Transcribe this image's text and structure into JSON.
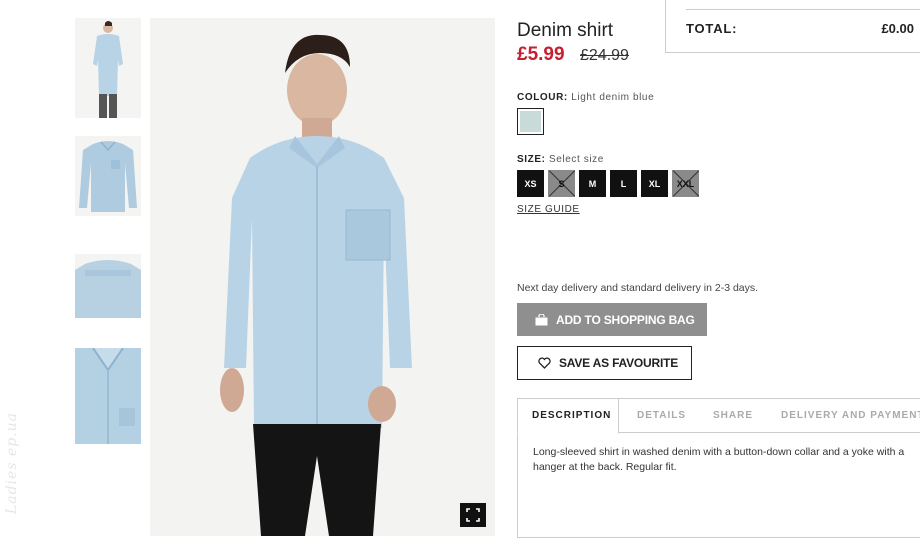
{
  "product": {
    "title": "Denim shirt",
    "price_sale": "£5.99",
    "price_original": "£24.99"
  },
  "cart": {
    "total_label": "TOTAL:",
    "total_value": "£0.00"
  },
  "colour": {
    "label": "COLOUR:",
    "value": "Light denim blue",
    "swatch_color": "#c9dbd9"
  },
  "size": {
    "label": "SIZE:",
    "placeholder": "Select size",
    "options": [
      {
        "label": "XS",
        "available": true
      },
      {
        "label": "S",
        "available": false
      },
      {
        "label": "M",
        "available": true
      },
      {
        "label": "L",
        "available": true
      },
      {
        "label": "XL",
        "available": true
      },
      {
        "label": "XXL",
        "available": false
      }
    ],
    "guide_label": "SIZE GUIDE"
  },
  "delivery_note": "Next day delivery and standard delivery in 2-3 days.",
  "actions": {
    "add_to_bag": "ADD TO SHOPPING BAG",
    "save_favourite": "SAVE AS FAVOURITE",
    "bag_icon": "shopping-bag-icon",
    "heart_icon": "heart-icon"
  },
  "info_tabs": {
    "tabs": [
      "DESCRIPTION",
      "DETAILS",
      "SHARE",
      "DELIVERY AND PAYMENT"
    ],
    "active": "DESCRIPTION",
    "description": "Long-sleeved shirt in washed denim with a button-down collar and a yoke with a hanger at the back. Regular fit."
  },
  "watermark": "Ladies ep.ua",
  "colors": {
    "sale_red": "#c81e2d",
    "denim": "#b9d3e6",
    "button_grey": "#8f8f8f"
  }
}
